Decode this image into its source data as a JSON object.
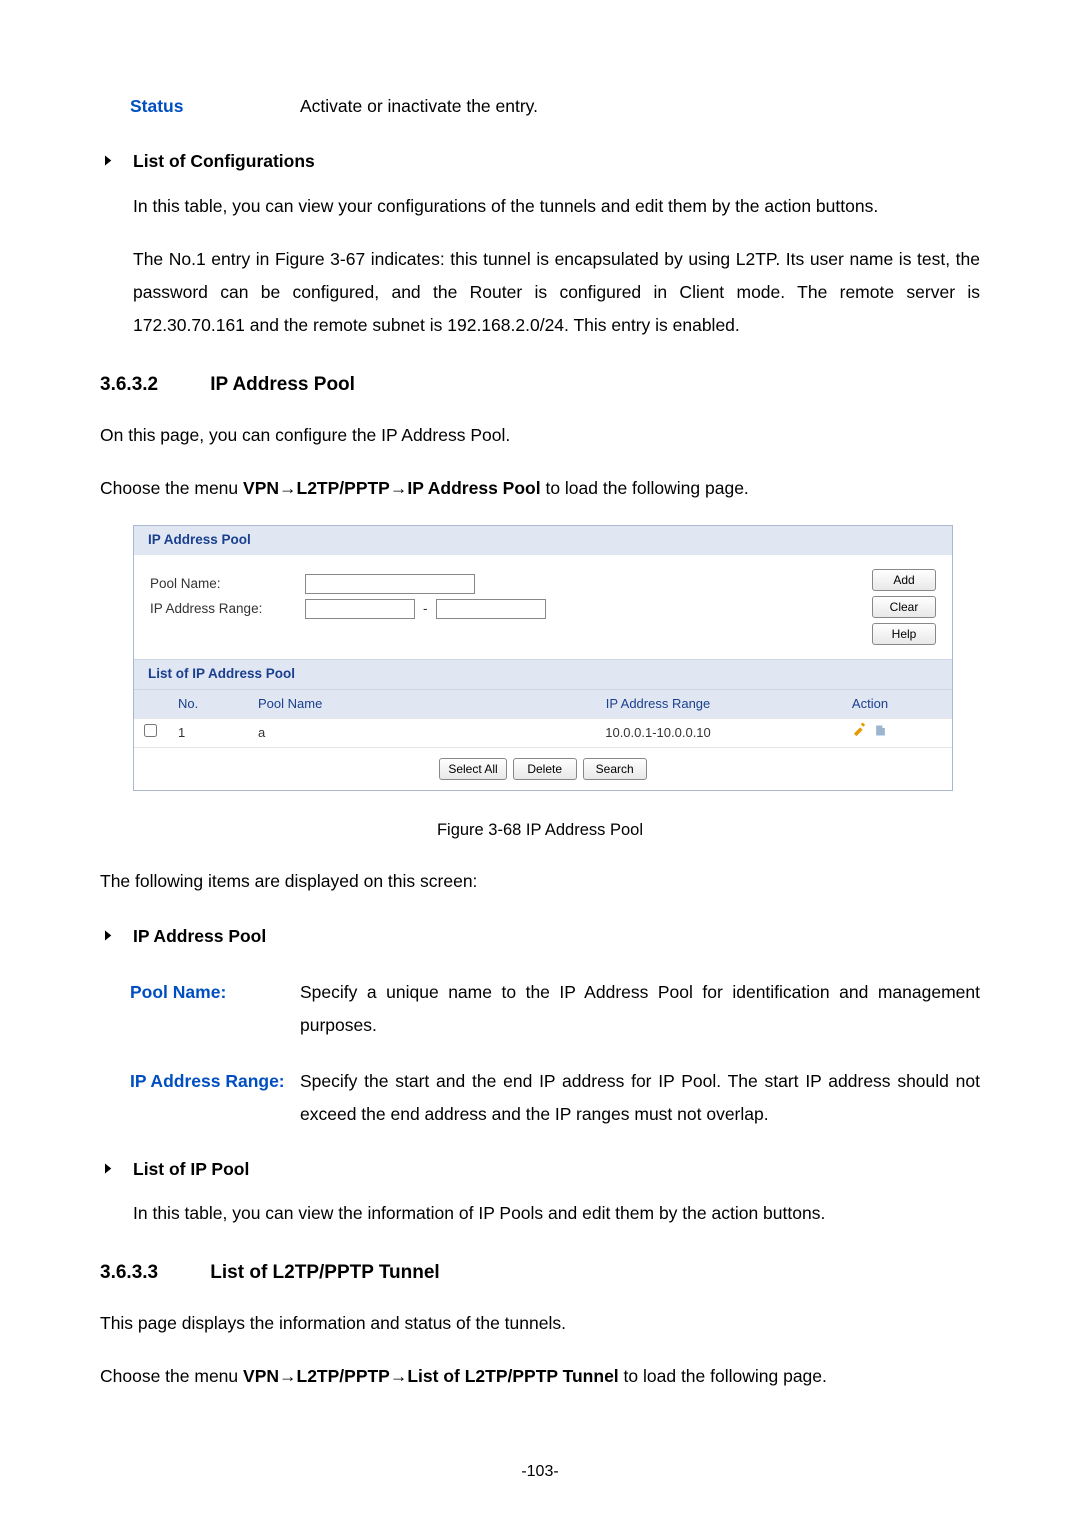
{
  "status_def": {
    "label": "Status",
    "desc": "Activate or inactivate the entry."
  },
  "list_conf": {
    "heading": "List of Configurations",
    "p1": "In this table, you can view your configurations of the tunnels and edit them by the action buttons.",
    "p2": "The No.1 entry in Figure 3-67 indicates: this tunnel is encapsulated by using L2TP. Its user name is test, the password can be configured, and the Router is configured in Client mode. The remote server is 172.30.70.161 and the remote subnet is 192.168.2.0/24. This entry is enabled."
  },
  "sec_3632": {
    "num": "3.6.3.2",
    "title": "IP Address Pool",
    "intro1": "On this page, you can configure the IP Address Pool.",
    "nav_prefix": "Choose the menu ",
    "nav_bold": "VPN→L2TP/PPTP→IP Address Pool",
    "nav_suffix": " to load the following page."
  },
  "panel": {
    "header": "IP Address Pool",
    "lbl_pool": "Pool Name:",
    "lbl_range": "IP Address Range:",
    "range_start": "",
    "range_end": "",
    "pool_name_value": "",
    "btn_add": "Add",
    "btn_clear": "Clear",
    "btn_help": "Help",
    "list_header": "List of IP Address Pool",
    "cols": {
      "no": "No.",
      "pool": "Pool Name",
      "range": "IP Address Range",
      "action": "Action"
    },
    "row": {
      "no": "1",
      "pool": "a",
      "range": "10.0.0.1-10.0.0.10"
    },
    "btn_selall": "Select All",
    "btn_delete": "Delete",
    "btn_search": "Search"
  },
  "caption": "Figure 3-68 IP Address Pool",
  "followitems": "The following items are displayed on this screen:",
  "ipap_def": {
    "heading": "IP Address Pool",
    "pool_label": "Pool Name:",
    "pool_desc": "Specify a unique name to the IP Address Pool for identification and management purposes.",
    "range_label": "IP Address Range:",
    "range_desc": "Specify the start and the end IP address for IP Pool. The start IP address should not exceed the end address and the IP ranges must not overlap."
  },
  "ipp": {
    "heading": "List of IP Pool",
    "p": "In this table, you can view the information of IP Pools and edit them by the action buttons."
  },
  "sec_3633": {
    "num": "3.6.3.3",
    "title": "List of L2TP/PPTP Tunnel",
    "intro": "This page displays the information and status of the tunnels.",
    "nav_prefix": "Choose the menu ",
    "nav_bold": "VPN→L2TP/PPTP→List of L2TP/PPTP Tunnel",
    "nav_suffix": " to load the following page."
  },
  "pagenum": "-103-"
}
